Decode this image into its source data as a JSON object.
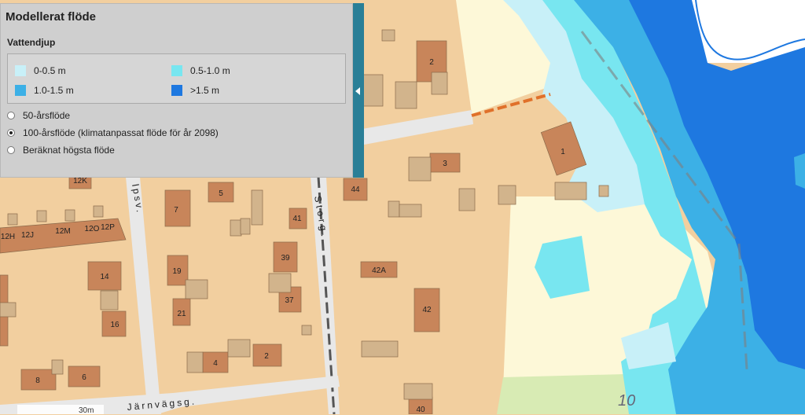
{
  "panel": {
    "title": "Modellerat flöde",
    "subtitle": "Vattendjup",
    "legend": [
      {
        "label": "0-0.5 m",
        "color": "#c8f0f8"
      },
      {
        "label": "0.5-1.0 m",
        "color": "#78e6f0"
      },
      {
        "label": "1.0-1.5 m",
        "color": "#3cb0e6"
      },
      {
        "label": ">1.5 m",
        "color": "#1e78e0"
      }
    ],
    "options": [
      {
        "label": "50-årsflöde",
        "selected": false
      },
      {
        "label": "100-årsflöde (klimatanpassat flöde för år 2098)",
        "selected": true
      },
      {
        "label": "Beräknat högsta flöde",
        "selected": false
      }
    ]
  },
  "map": {
    "building_numbers": [
      "2",
      "1",
      "3",
      "44",
      "5",
      "7",
      "41",
      "39",
      "42A",
      "42",
      "37",
      "19",
      "14",
      "21",
      "16",
      "4",
      "2",
      "8",
      "6",
      "40",
      "12H",
      "12J",
      "12M",
      "12O",
      "12P",
      "12K"
    ],
    "streets": [
      "Storg.",
      "Järnvägsg.",
      "lpsv."
    ],
    "contour_label": "10",
    "scale_label": "30m"
  }
}
